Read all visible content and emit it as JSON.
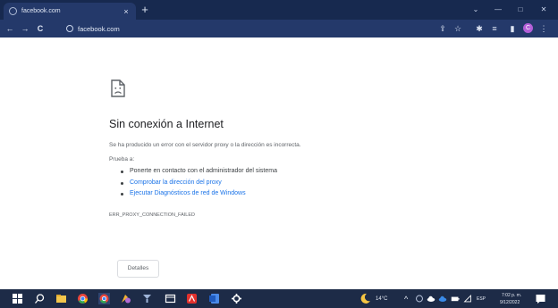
{
  "browser": {
    "tab_title": "facebook.com",
    "tab_close": "×",
    "new_tab": "+",
    "url": "facebook.com",
    "profile_initial": "C"
  },
  "window_controls": {
    "chevron": "⌄",
    "minimize": "—",
    "maximize": "□",
    "close": "✕"
  },
  "toolbar_icons": {
    "back": "←",
    "forward": "→",
    "reload": "C",
    "share": "⇪",
    "bookmark": "☆",
    "extensions": "✱",
    "reading_list": "≡",
    "side_panel": "▮",
    "menu": "⋮"
  },
  "error_page": {
    "heading": "Sin conexión a Internet",
    "subtitle": "Se ha producido un error con el servidor proxy o la dirección es incorrecta.",
    "try_label": "Prueba a:",
    "suggestions": [
      {
        "text": "Ponerte en contacto con el administrador del sistema",
        "link": false
      },
      {
        "text": "Comprobar la dirección del proxy",
        "link": true
      },
      {
        "text": "Ejecutar Diagnósticos de red de Windows",
        "link": true
      }
    ],
    "error_code": "ERR_PROXY_CONNECTION_FAILED",
    "details_button": "Detalles"
  },
  "taskbar": {
    "temperature": "14°C",
    "language": "ESP",
    "time": "7:02 p. m.",
    "date": "9/12/2022",
    "up_arrow": "^"
  },
  "colors": {
    "tabstrip": "#17294f",
    "toolbar": "#24396a",
    "link": "#1a73e8",
    "taskbar": "#1d2b47"
  }
}
